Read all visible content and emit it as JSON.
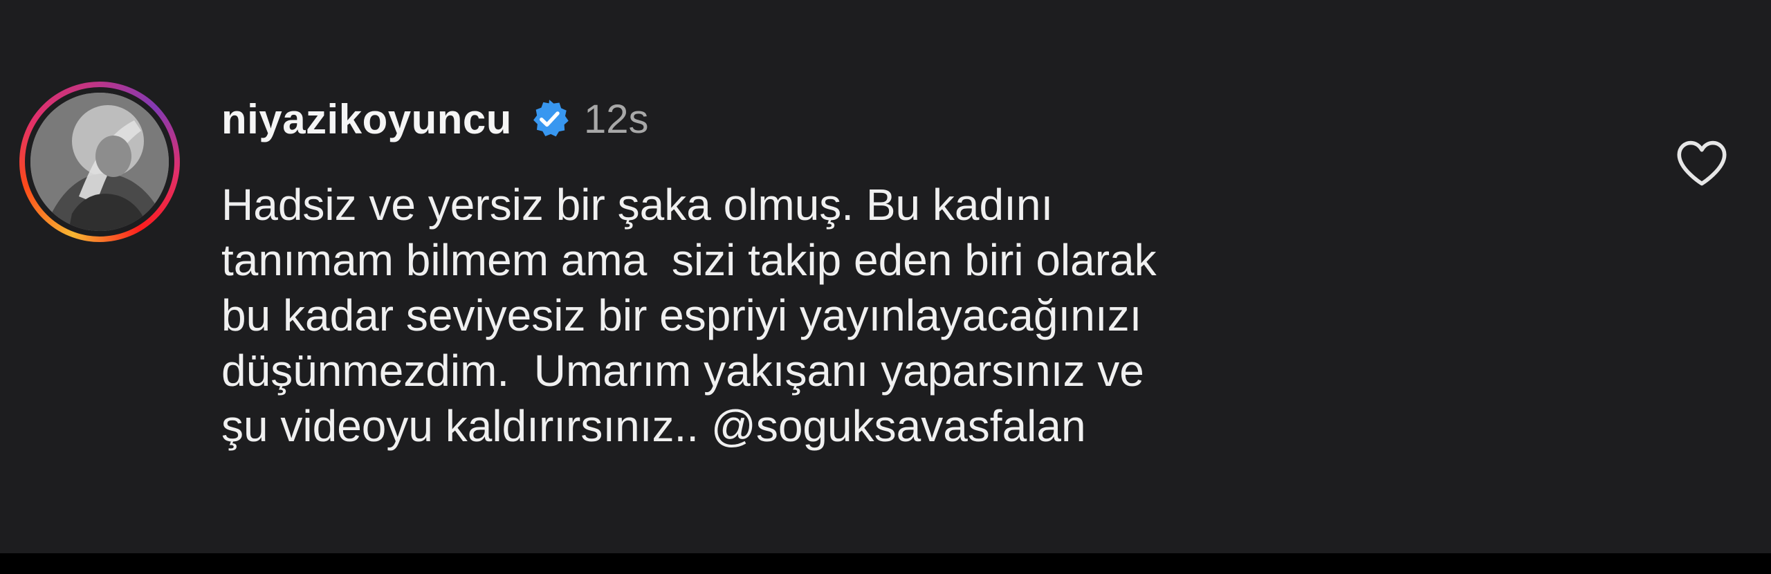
{
  "comment": {
    "username": "niyazikoyuncu",
    "timestamp": "12s",
    "verified": true,
    "lines": [
      "Hadsiz ve yersiz bir şaka olmuş. Bu kadını",
      "tanımam bilmem ama  sizi takip eden biri olarak",
      "bu kadar seviyesiz bir espriyi yayınlayacağınızı",
      "düşünmezdim.  Umarım yakışanı yaparsınız ve",
      "şu videoyu kaldırırsınız.. @soguksavasfalan"
    ],
    "icons": {
      "avatar": "profile-photo",
      "verified": "verified-badge-icon",
      "like": "heart-outline-icon"
    }
  },
  "colors": {
    "background": "#1d1d1f",
    "text": "#f0f0f0",
    "muted": "#a8a8a8",
    "verified_badge": "#3897f0"
  }
}
